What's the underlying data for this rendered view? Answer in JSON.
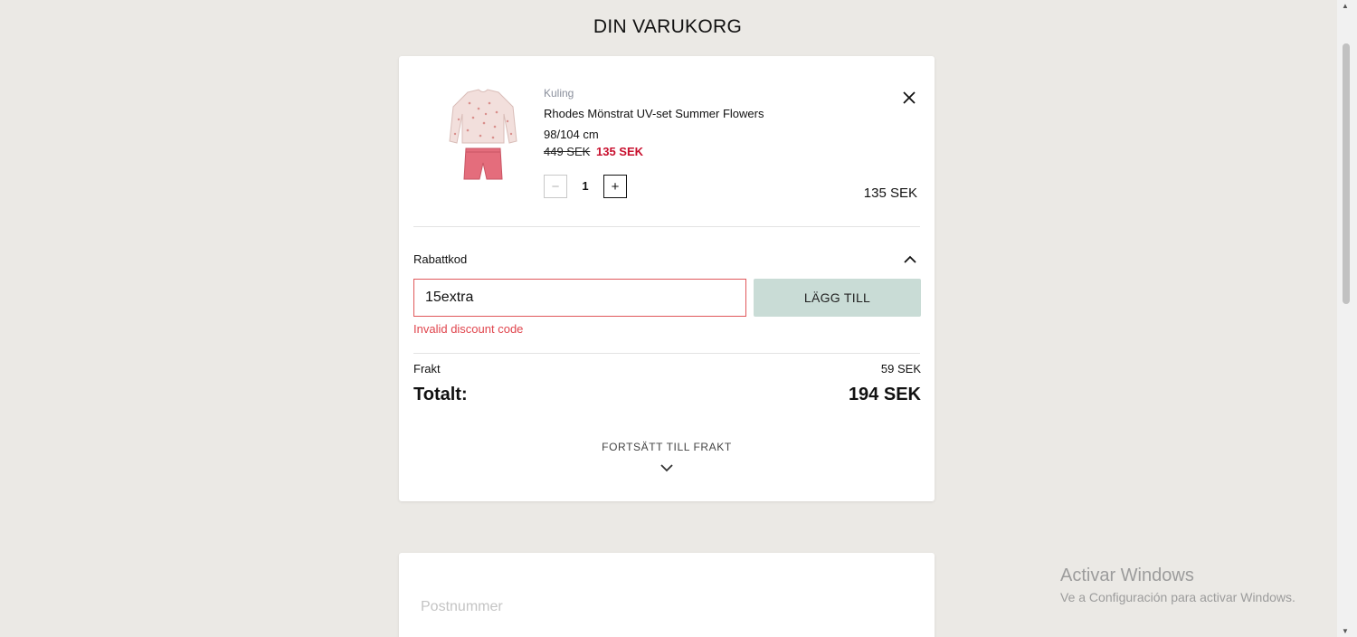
{
  "page": {
    "title": "DIN VARUKORG"
  },
  "cart_item": {
    "brand": "Kuling",
    "name": "Rhodes Mönstrat UV-set Summer Flowers",
    "size": "98/104 cm",
    "old_price": "449 SEK",
    "new_price": "135 SEK",
    "quantity": "1",
    "line_total": "135 SEK",
    "minus_symbol": "−",
    "plus_symbol": "+"
  },
  "discount": {
    "label": "Rabattkod",
    "input_value": "15extra",
    "apply_label": "LÄGG TILL",
    "error": "Invalid discount code"
  },
  "summary": {
    "shipping_label": "Frakt",
    "shipping_value": "59 SEK",
    "total_label": "Totalt:",
    "total_value": "194 SEK"
  },
  "continue": {
    "label": "FORTSÄTT TILL FRAKT"
  },
  "address": {
    "postcode_placeholder": "Postnummer"
  },
  "windows_watermark": {
    "title": "Activar Windows",
    "subtitle": "Ve a Configuración para activar Windows."
  },
  "colors": {
    "background": "#ebe9e5",
    "sale_red": "#c8102e",
    "error_red": "#e0454d",
    "apply_button": "#c9dcd6"
  },
  "icons": [
    "close-icon",
    "chevron-up-icon",
    "chevron-down-icon",
    "minus-icon",
    "plus-icon"
  ]
}
